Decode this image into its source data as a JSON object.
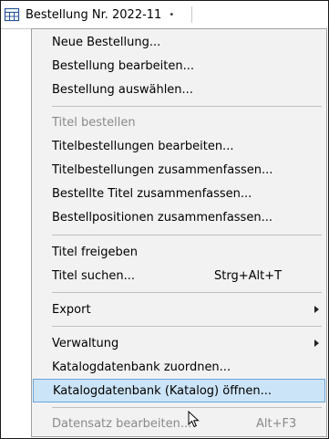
{
  "toolbar": {
    "title": "Bestellung Nr. 2022-11",
    "dropdown_arrow": "•",
    "icon": "table-icon"
  },
  "menu": {
    "items": [
      {
        "label": "Neue Bestellung..."
      },
      {
        "label": "Bestellung bearbeiten..."
      },
      {
        "label": "Bestellung auswählen..."
      },
      {
        "label": "Titel bestellen",
        "disabled": true
      },
      {
        "label": "Titelbestellungen bearbeiten..."
      },
      {
        "label": "Titelbestellungen zusammenfassen..."
      },
      {
        "label": "Bestellte Titel zusammenfassen..."
      },
      {
        "label": "Bestellpositionen zusammenfassen..."
      },
      {
        "label": "Titel freigeben"
      },
      {
        "label": "Titel suchen...",
        "shortcut": "Strg+Alt+T"
      },
      {
        "label": "Export",
        "submenu": true
      },
      {
        "label": "Verwaltung",
        "submenu": true
      },
      {
        "label": "Katalogdatenbank zuordnen..."
      },
      {
        "label": "Katalogdatenbank (Katalog) öffnen...",
        "highlighted": true
      },
      {
        "label": "Datensatz bearbeiten...",
        "shortcut": "Alt+F3",
        "disabled": true
      }
    ]
  },
  "colors": {
    "highlight_bg": "#cce4f7",
    "highlight_border": "#6aa5d8",
    "menu_bg": "#f2f2f2",
    "disabled_text": "#8a8a8a"
  }
}
